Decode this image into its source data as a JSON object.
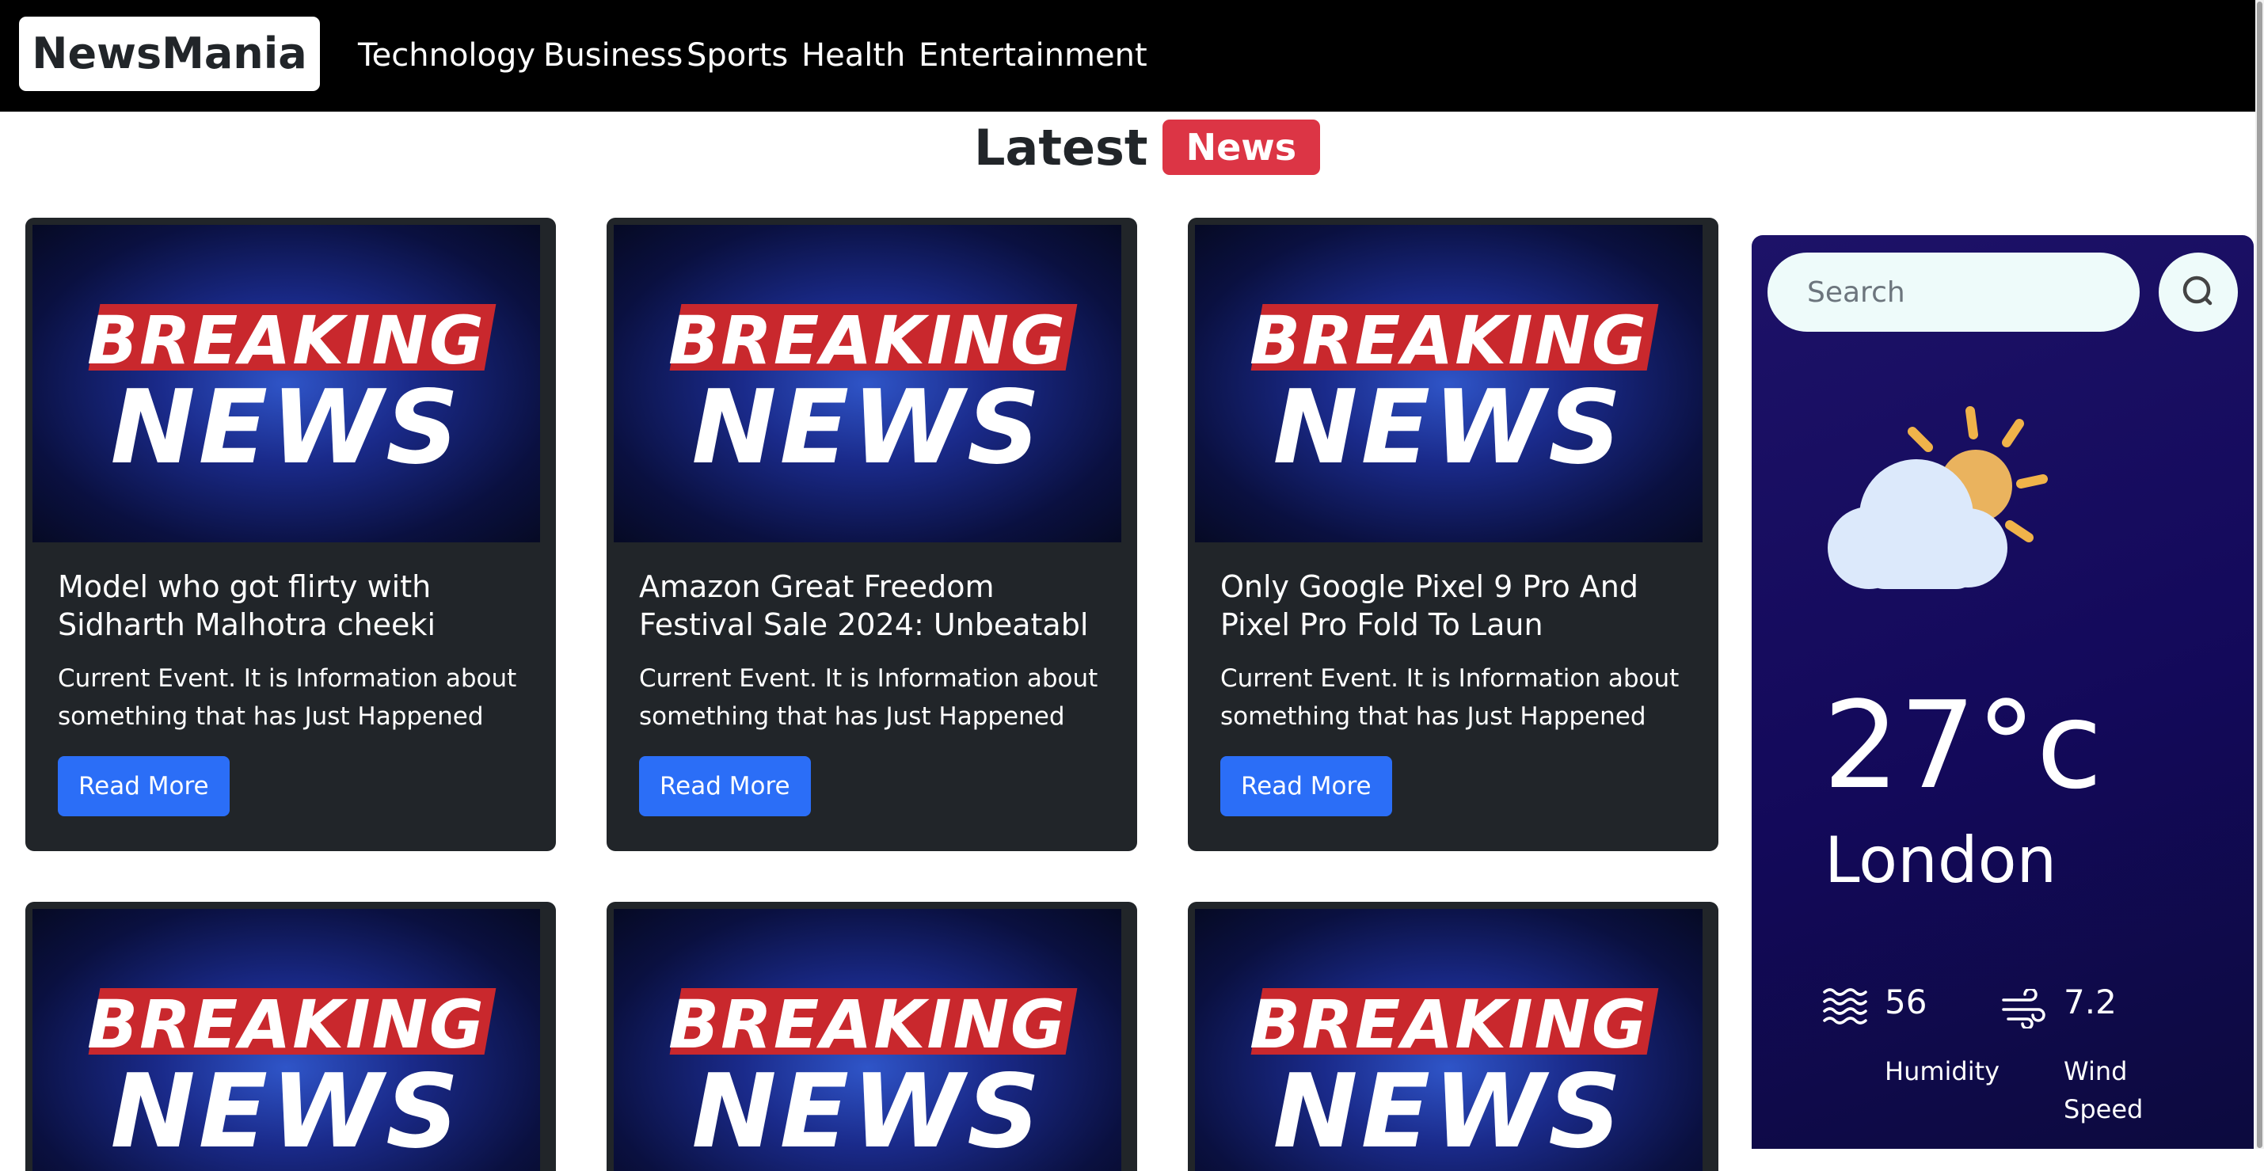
{
  "navbar": {
    "brand": "NewsMania",
    "links": [
      "Technology",
      "Business",
      "Sports",
      "Health",
      "Entertainment"
    ]
  },
  "heading": {
    "text": "Latest",
    "badge": "News"
  },
  "card_image": {
    "line1": "BREAKING",
    "line2": "NEWS"
  },
  "cards": [
    {
      "title": "Model who got flirty with Sidharth Malhotra cheeki",
      "text": "Current Event. It is Information about something that has Just Happened",
      "button": "Read More"
    },
    {
      "title": "Amazon Great Freedom Festival Sale 2024: Unbeatabl",
      "text": "Current Event. It is Information about something that has Just Happened",
      "button": "Read More"
    },
    {
      "title": "Only Google Pixel 9 Pro And Pixel Pro Fold To Laun",
      "text": "Current Event. It is Information about something that has Just Happened",
      "button": "Read More"
    }
  ],
  "weather": {
    "search_placeholder": "Search",
    "temperature": "27°c",
    "city": "London",
    "humidity_value": "56",
    "humidity_label": "Humidity",
    "wind_value": "7.2",
    "wind_label": "Wind Speed"
  },
  "colors": {
    "navbar": "#000000",
    "badge": "#dc3545",
    "card": "#212529",
    "button": "#2b6ef7",
    "weather_panel": "#160b5e",
    "search_bg": "#eefbfa"
  },
  "icons": [
    "search-icon",
    "sun-cloud-icon",
    "humidity-icon",
    "wind-icon"
  ]
}
